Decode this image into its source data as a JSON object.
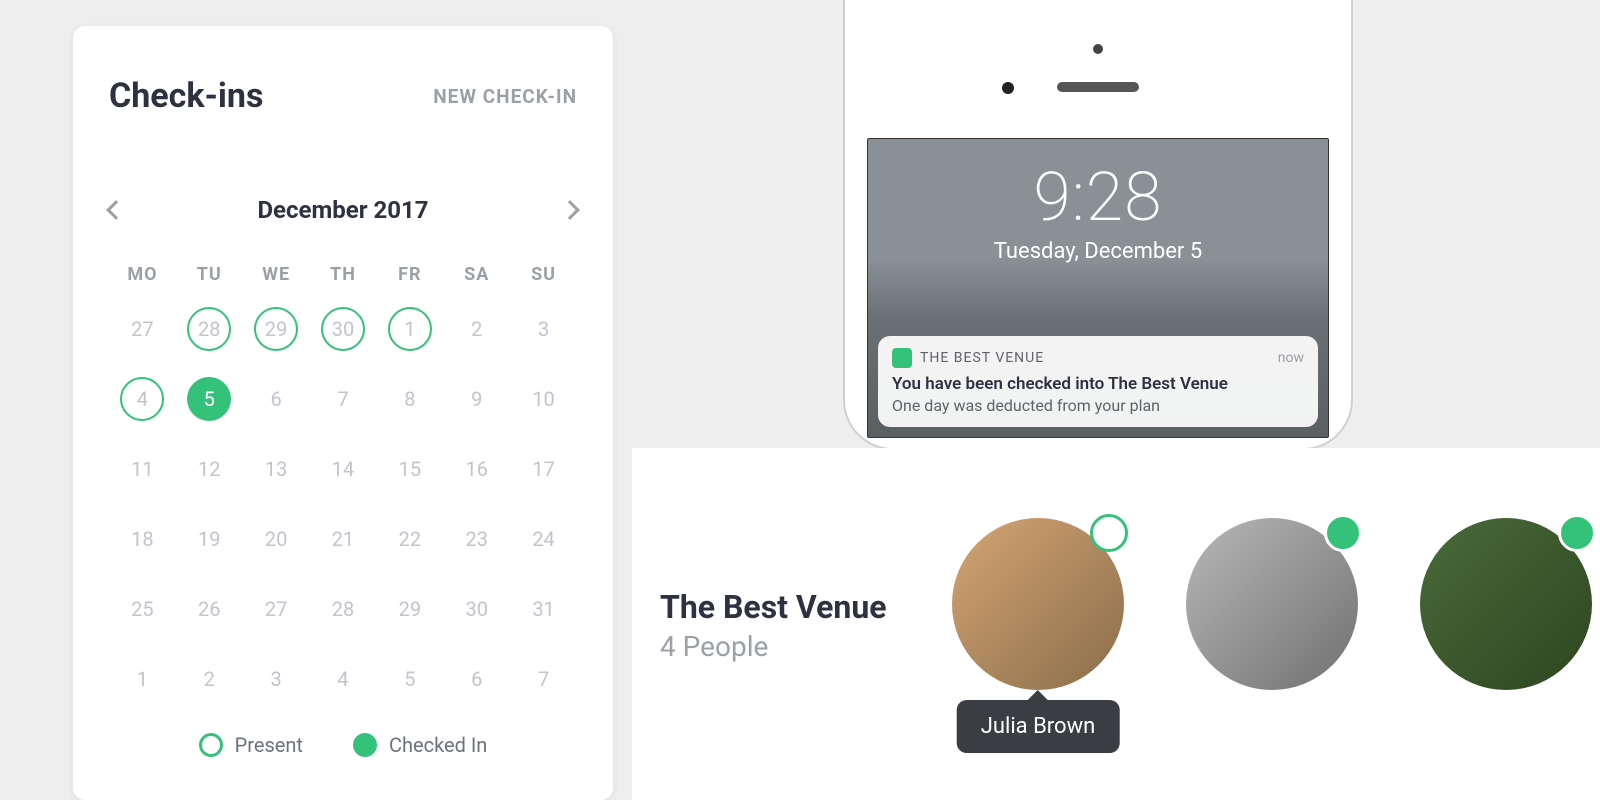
{
  "card": {
    "title": "Check-ins",
    "new_label": "NEW CHECK-IN",
    "month": "December 2017",
    "dow": [
      "MO",
      "TU",
      "WE",
      "TH",
      "FR",
      "SA",
      "SU"
    ],
    "weeks": [
      [
        {
          "d": "27"
        },
        {
          "d": "28",
          "s": "present"
        },
        {
          "d": "29",
          "s": "present"
        },
        {
          "d": "30",
          "s": "present"
        },
        {
          "d": "1",
          "s": "present"
        },
        {
          "d": "2"
        },
        {
          "d": "3"
        }
      ],
      [
        {
          "d": "4",
          "s": "present"
        },
        {
          "d": "5",
          "s": "checkedin"
        },
        {
          "d": "6"
        },
        {
          "d": "7"
        },
        {
          "d": "8"
        },
        {
          "d": "9"
        },
        {
          "d": "10"
        }
      ],
      [
        {
          "d": "11"
        },
        {
          "d": "12"
        },
        {
          "d": "13"
        },
        {
          "d": "14"
        },
        {
          "d": "15"
        },
        {
          "d": "16"
        },
        {
          "d": "17"
        }
      ],
      [
        {
          "d": "18"
        },
        {
          "d": "19"
        },
        {
          "d": "20"
        },
        {
          "d": "21"
        },
        {
          "d": "22"
        },
        {
          "d": "23"
        },
        {
          "d": "24"
        }
      ],
      [
        {
          "d": "25"
        },
        {
          "d": "26"
        },
        {
          "d": "27"
        },
        {
          "d": "28"
        },
        {
          "d": "29"
        },
        {
          "d": "30"
        },
        {
          "d": "31"
        }
      ],
      [
        {
          "d": "1"
        },
        {
          "d": "2"
        },
        {
          "d": "3"
        },
        {
          "d": "4"
        },
        {
          "d": "5"
        },
        {
          "d": "6"
        },
        {
          "d": "7"
        }
      ]
    ],
    "legend": {
      "present": "Present",
      "checkedin": "Checked In"
    }
  },
  "phone": {
    "time": "9:28",
    "date": "Tuesday, December 5",
    "notif": {
      "app": "THE BEST VENUE",
      "when": "now",
      "title": "You have been checked into The Best Venue",
      "body": "One day was deducted from your plan"
    }
  },
  "venue": {
    "title": "The Best Venue",
    "subtitle": "4 People",
    "people": [
      {
        "name": "Julia Brown",
        "status": "present"
      },
      {
        "name": "",
        "status": "checkedin"
      },
      {
        "name": "",
        "status": "checkedin"
      }
    ]
  },
  "colors": {
    "accent": "#34c27b"
  }
}
